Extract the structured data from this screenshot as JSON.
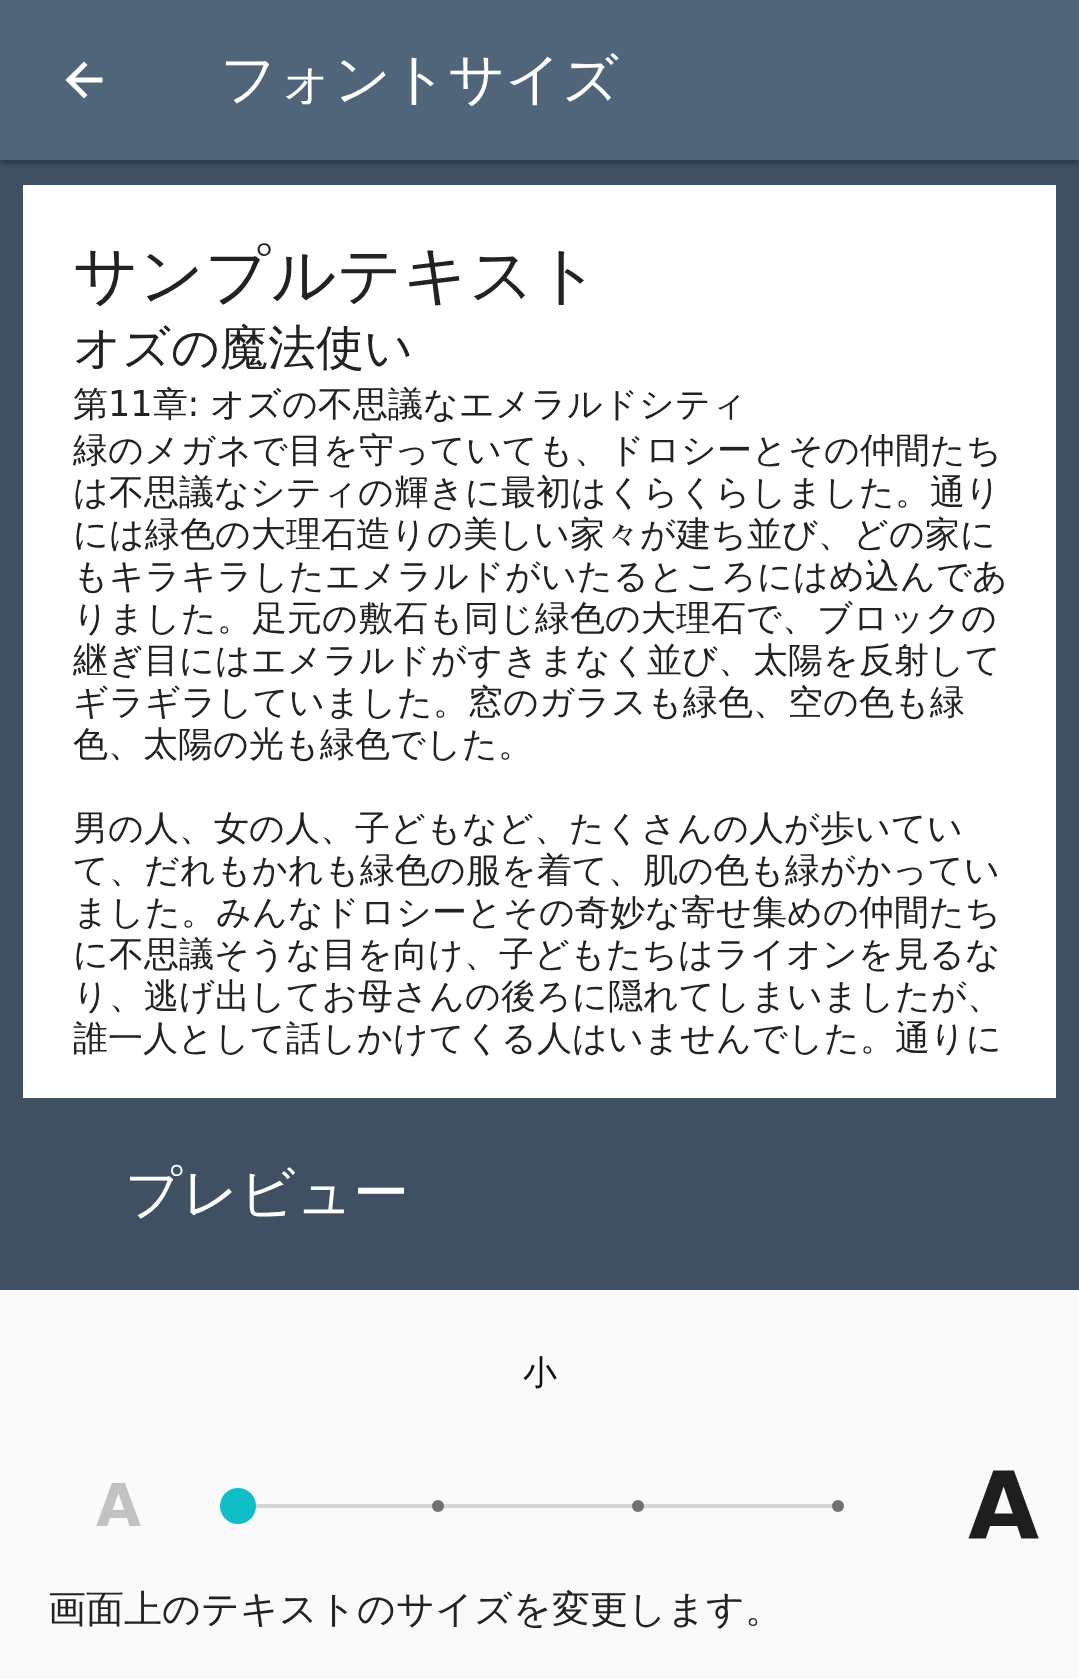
{
  "app_bar": {
    "title": "フォントサイズ"
  },
  "preview": {
    "title": "サンプルテキスト",
    "subtitle": "オズの魔法使い",
    "chapter": "第11章: オズの不思議なエメラルドシティ",
    "paragraphs": [
      "緑のメガネで目を守っていても、ドロシーとその仲間たちは不思議なシティの輝きに最初はくらくらしました。通りには緑色の大理石造りの美しい家々が建ち並び、どの家にもキラキラしたエメラルドがいたるところにはめ込んでありました。足元の敷石も同じ緑色の大理石で、ブロックの継ぎ目にはエメラルドがすきまなく並び、太陽を反射してギラギラしていました。窓のガラスも緑色、空の色も緑色、太陽の光も緑色でした。",
      "男の人、女の人、子どもなど、たくさんの人が歩いていて、だれもかれも緑色の服を着て、肌の色も緑がかっていました。みんなドロシーとその奇妙な寄せ集めの仲間たちに不思議そうな目を向け、子どもたちはライオンを見るなり、逃げ出してお母さんの後ろに隠れてしまいましたが、誰一人として話しかけてくる人はいませんでした。通りに"
    ],
    "label": "プレビュー"
  },
  "size_control": {
    "current_size": "小",
    "small_label": "A",
    "large_label": "A",
    "level": 0,
    "description": "画面上のテキストのサイズを変更します。"
  }
}
